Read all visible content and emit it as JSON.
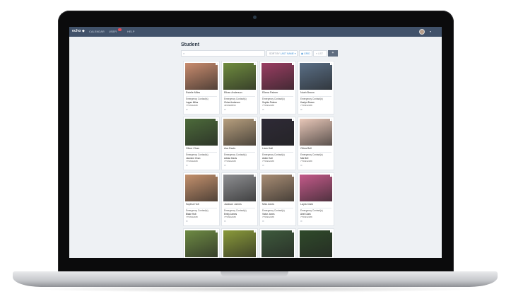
{
  "app": {
    "logo": "echo ◆",
    "nav": [
      "CALENDAR",
      "USER",
      "HELP"
    ],
    "page_title": "Student"
  },
  "toolbar": {
    "search_placeholder": "⌕",
    "sort_label": "SORT BY",
    "sort_value": "LAST NAME",
    "grid_label": "GRID",
    "list_label": "LIST",
    "add_label": "+"
  },
  "cards": [
    {
      "name": "Estelle Miles",
      "contact_label": "Emergency Contact(s)",
      "contact": "Logan Miles",
      "phone": "7753932488",
      "photo": "#c98c6e"
    },
    {
      "name": "Ethan Anderson",
      "contact_label": "Emergency Contact(s)",
      "contact": "Chloe Anderson",
      "phone": "4653998553",
      "photo": "#6f8c3e"
    },
    {
      "name": "Ellena Palmer",
      "contact_label": "Emergency Contact(s)",
      "contact": "Sophia Palmer",
      "phone": "7753932488",
      "photo": "#9a3d62"
    },
    {
      "name": "Noah Brown",
      "contact_label": "Emergency Contact(s)",
      "contact": "Kaelyn Brown",
      "phone": "7753932488",
      "photo": "#5a6f86"
    },
    {
      "name": "Oliver Chan",
      "contact_label": "Emergency Contact(s)",
      "contact": "Jasmine Chan",
      "phone": "7753932488",
      "photo": "#4c6a3a"
    },
    {
      "name": "Ava Davis",
      "contact_label": "Emergency Contact(s)",
      "contact": "Adrian Davis",
      "phone": "7753932488",
      "photo": "#b79f7e"
    },
    {
      "name": "Liam Hall",
      "contact_label": "Emergency Contact(s)",
      "contact": "Aiden Hall",
      "phone": "7753932488",
      "photo": "#2e2a36"
    },
    {
      "name": "Olivia Bell",
      "contact_label": "Emergency Contact(s)",
      "contact": "Mia Bell",
      "phone": "7753932488",
      "photo": "#e8c7b8"
    },
    {
      "name": "Sophia Holt",
      "contact_label": "Emergency Contact(s)",
      "contact": "Blake Holt",
      "phone": "7753932488",
      "photo": "#c4916d"
    },
    {
      "name": "Jackson James",
      "contact_label": "Emergency Contact(s)",
      "contact": "Emily James",
      "phone": "7753932488",
      "photo": "#8e8f92"
    },
    {
      "name": "Mila Jones",
      "contact_label": "Emergency Contact(s)",
      "contact": "Victor Jones",
      "phone": "7753932488",
      "photo": "#a88d74"
    },
    {
      "name": "Layla Clark",
      "contact_label": "Emergency Contact(s)",
      "contact": "Ariel Clark",
      "phone": "7753932488",
      "photo": "#c45a8a"
    },
    {
      "name": "",
      "contact_label": "",
      "contact": "",
      "phone": "",
      "photo": "#6d8a43"
    },
    {
      "name": "",
      "contact_label": "",
      "contact": "",
      "phone": "",
      "photo": "#8a9a3a"
    },
    {
      "name": "",
      "contact_label": "",
      "contact": "",
      "phone": "",
      "photo": "#3e5a3c"
    },
    {
      "name": "",
      "contact_label": "",
      "contact": "",
      "phone": "",
      "photo": "#2f4a2a"
    }
  ]
}
